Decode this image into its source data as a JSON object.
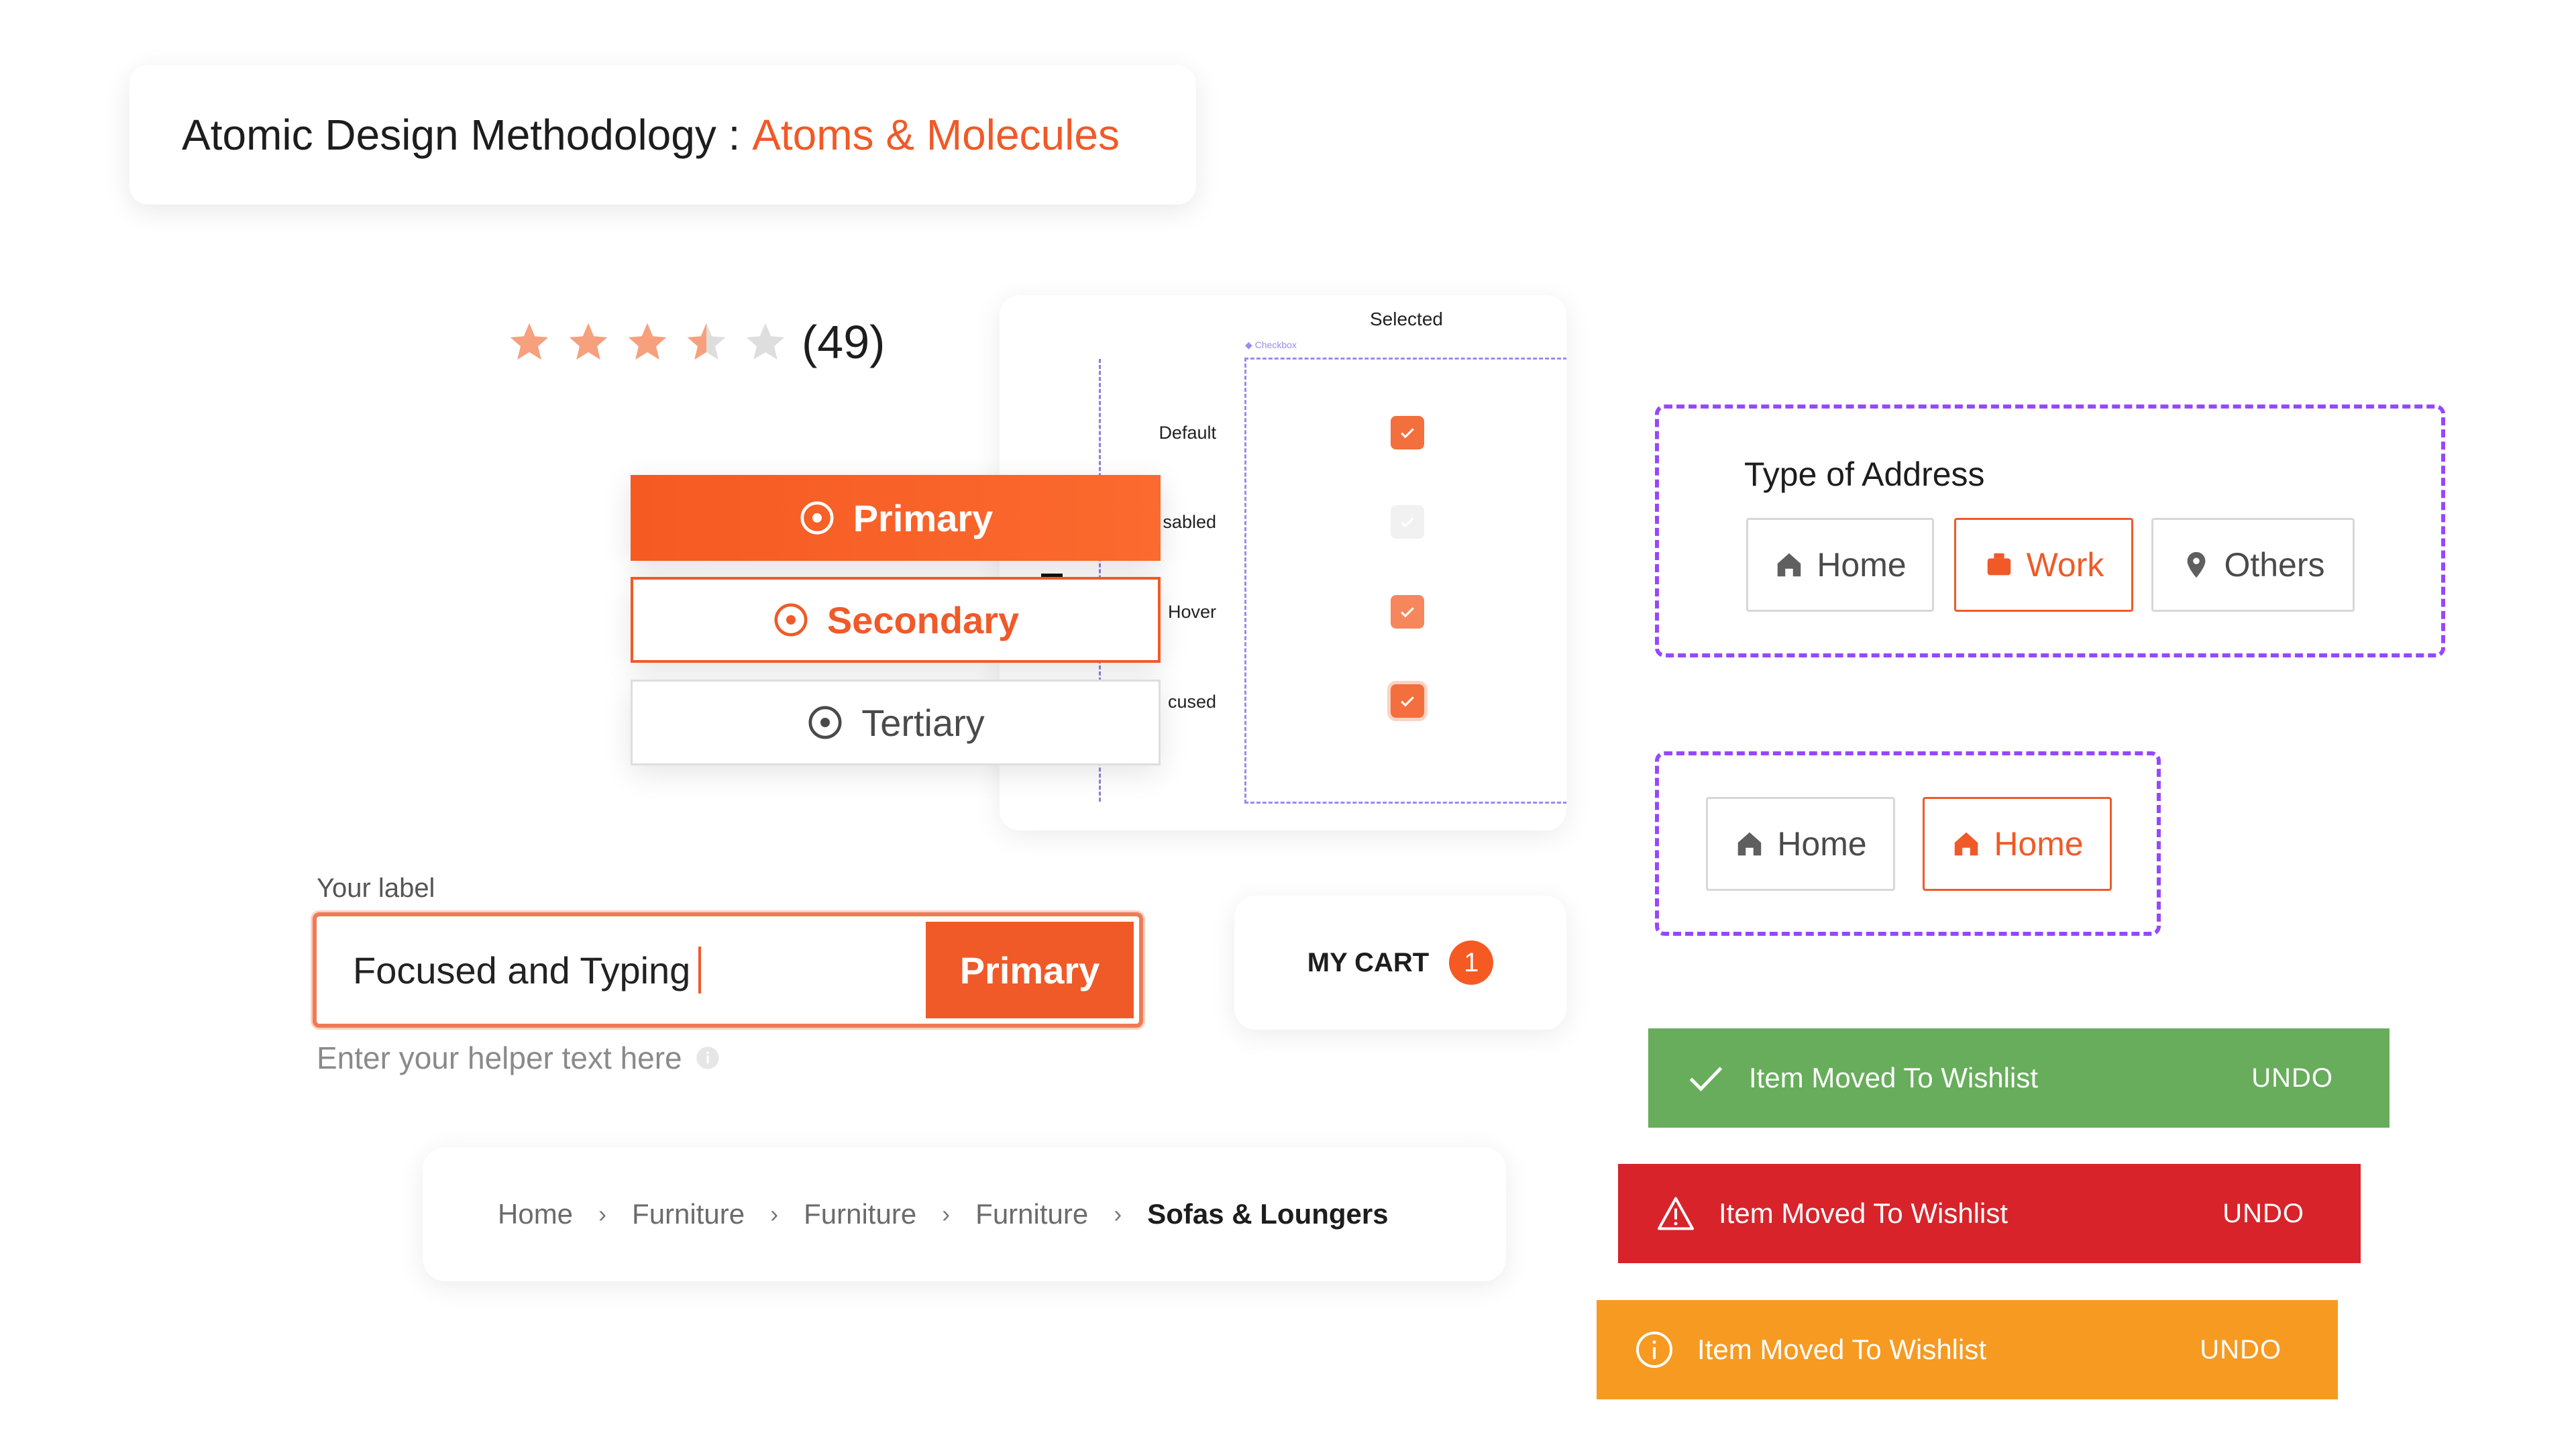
{
  "title": {
    "prefix": "Atomic Design Methodology : ",
    "accent": "Atoms & Molecules"
  },
  "rating": {
    "value": 3.5,
    "max": 5,
    "count_label": "(49)"
  },
  "checkbox_spec": {
    "column_title": "Selected",
    "box_tag": "◆ Checkbox",
    "rows": [
      {
        "label": "Default",
        "state": "checked"
      },
      {
        "label": "sabled",
        "state": "disabled"
      },
      {
        "label": "Hover",
        "state": "checked"
      },
      {
        "label": "cused",
        "state": "focused"
      }
    ]
  },
  "buttons": {
    "primary": "Primary",
    "secondary": "Secondary",
    "tertiary": "Tertiary"
  },
  "input_group": {
    "label": "Your label",
    "value": "Focused and Typing",
    "button": "Primary",
    "helper": "Enter your helper text here"
  },
  "cart": {
    "label": "MY CART",
    "count": "1"
  },
  "breadcrumb": {
    "items": [
      "Home",
      "Furniture",
      "Furniture",
      "Furniture"
    ],
    "separator": "›",
    "current": "Sofas & Loungers"
  },
  "address": {
    "title": "Type of Address",
    "options": [
      {
        "label": "Home",
        "icon": "home-icon",
        "selected": false
      },
      {
        "label": "Work",
        "icon": "briefcase-icon",
        "selected": true
      },
      {
        "label": "Others",
        "icon": "location-pin-icon",
        "selected": false
      }
    ]
  },
  "home_chips": [
    {
      "label": "Home",
      "selected": false
    },
    {
      "label": "Home",
      "selected": true
    }
  ],
  "toasts": [
    {
      "type": "success",
      "message": "Item Moved To Wishlist",
      "action": "UNDO",
      "color": "#67ad5b"
    },
    {
      "type": "error",
      "message": "Item Moved To Wishlist",
      "action": "UNDO",
      "color": "#d8232a"
    },
    {
      "type": "warning",
      "message": "Item Moved To Wishlist",
      "action": "UNDO",
      "color": "#f69a21"
    }
  ],
  "colors": {
    "accent": "#f05a28",
    "star": "#f6a07e",
    "star_empty": "#dedede",
    "dashed_frame": "#9747ff"
  }
}
